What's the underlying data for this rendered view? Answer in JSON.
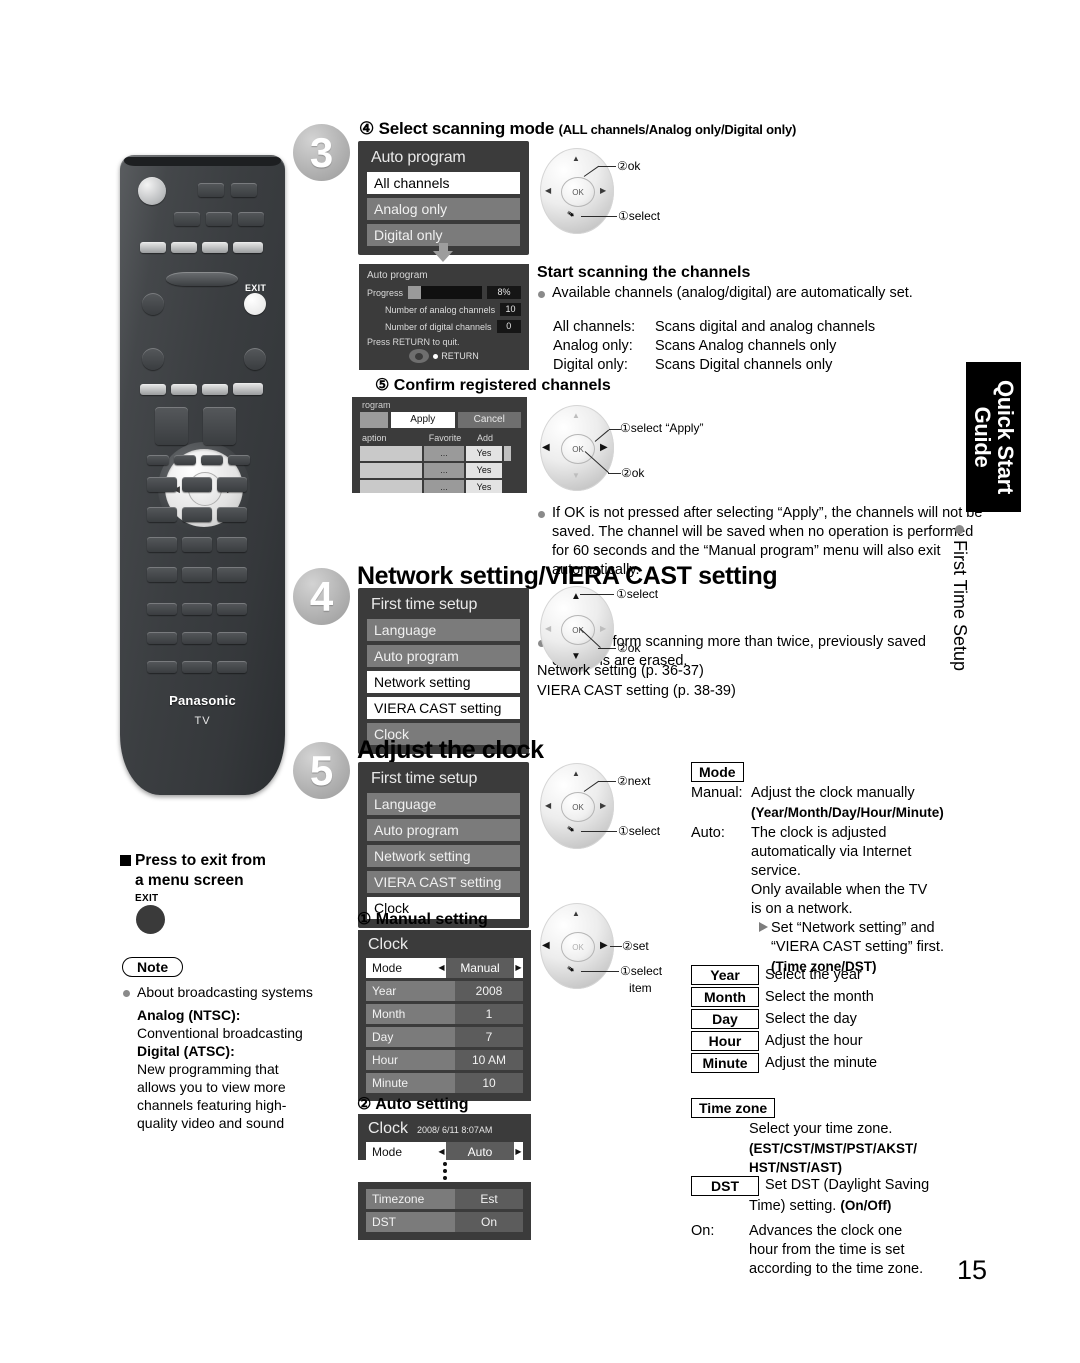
{
  "page": {
    "number": "15"
  },
  "side_tab": {
    "title_line1": "Quick Start",
    "title_line2": "Guide",
    "subtitle": "First Time Setup"
  },
  "remote": {
    "brand": "Panasonic",
    "model_label": "TV",
    "exit_label": "EXIT",
    "ok_label": "OK"
  },
  "step3": {
    "number": "3",
    "heading_num": "④",
    "heading": "Select scanning mode",
    "heading_paren": "(ALL channels/Analog only/Digital only)",
    "menu": {
      "title": "Auto program",
      "items": [
        {
          "label": "All channels",
          "selected": true
        },
        {
          "label": "Analog only",
          "selected": false
        },
        {
          "label": "Digital only",
          "selected": false
        }
      ]
    },
    "dial": {
      "callout1": "②ok",
      "callout2": "①select",
      "ok": "OK"
    },
    "progress_panel": {
      "title": "Auto program",
      "progress_label": "Progress",
      "progress_value": "8%",
      "progress_percent": 8,
      "analog_label": "Number of analog channels",
      "analog_value": "10",
      "digital_label": "Number of digital channels",
      "digital_value": "0",
      "quit_text": "Press RETURN to quit.",
      "return_label": "RETURN"
    },
    "scanning": {
      "heading": "Start scanning the channels",
      "bullet": "Available channels (analog/digital) are automatically set.",
      "rows": [
        {
          "key": "All channels:",
          "val": "Scans digital and analog channels"
        },
        {
          "key": "Analog only:",
          "val": "Scans Analog channels only"
        },
        {
          "key": "Digital only:",
          "val": "Scans Digital channels only"
        }
      ]
    },
    "confirm": {
      "heading_num": "⑤",
      "heading": "Confirm registered channels",
      "panel": {
        "title": "rogram",
        "apply": "Apply",
        "cancel": "Cancel",
        "col_caption": "aption",
        "col_favorite": "Favorite",
        "col_add": "Add",
        "rows": [
          {
            "dash": ".",
            "fav": "...",
            "add": "Yes"
          },
          {
            "dash": ".",
            "fav": "...",
            "add": "Yes"
          },
          {
            "dash": ".",
            "fav": "...",
            "add": "Yes"
          }
        ]
      },
      "dial": {
        "callout1": "①select “Apply”",
        "callout2": "②ok",
        "ok": "OK"
      },
      "bullets": [
        "If OK is not pressed after selecting “Apply”, the channels will not be saved. The channel will be saved when no operation is performed for 60 seconds and the “Manual program” menu will also exit automatically.",
        "If you perform scanning more than twice, previously saved channels are erased."
      ]
    }
  },
  "step4": {
    "number": "4",
    "heading": "Network setting/VIERA CAST setting",
    "menu": {
      "title": "First time setup",
      "items": [
        {
          "label": "Language",
          "selected": false
        },
        {
          "label": "Auto program",
          "selected": false
        },
        {
          "label": "Network setting",
          "selected": true
        },
        {
          "label": "VIERA CAST setting",
          "selected": true
        },
        {
          "label": "Clock",
          "selected": false
        }
      ]
    },
    "dial": {
      "callout1": "①select",
      "callout2": "②ok",
      "ok": "OK"
    },
    "refs": [
      "Network setting (p. 36-37)",
      "VIERA CAST setting (p. 38-39)"
    ]
  },
  "step5": {
    "number": "5",
    "heading": "Adjust the clock",
    "menu": {
      "title": "First time setup",
      "items": [
        {
          "label": "Language",
          "selected": false
        },
        {
          "label": "Auto program",
          "selected": false
        },
        {
          "label": "Network setting",
          "selected": false
        },
        {
          "label": "VIERA CAST setting",
          "selected": false
        },
        {
          "label": "Clock",
          "selected": true
        }
      ]
    },
    "dial": {
      "callout1": "②next",
      "callout2": "①select",
      "ok": "OK"
    },
    "manual": {
      "heading_num": "①",
      "heading": "Manual setting",
      "title": "Clock",
      "rows": [
        {
          "key": "Mode",
          "val": "Manual",
          "arrows": true,
          "white": true
        },
        {
          "key": "Year",
          "val": "2008",
          "arrows": false,
          "white": false
        },
        {
          "key": "Month",
          "val": "1",
          "arrows": false,
          "white": false
        },
        {
          "key": "Day",
          "val": "7",
          "arrows": false,
          "white": false
        },
        {
          "key": "Hour",
          "val": "10 AM",
          "arrows": false,
          "white": false
        },
        {
          "key": "Minute",
          "val": "10",
          "arrows": false,
          "white": false
        }
      ],
      "dial": {
        "callout1": "②set",
        "callout2": "①select",
        "callout2b": "item",
        "ok": "OK"
      }
    },
    "auto": {
      "heading_num": "②",
      "heading": "Auto setting",
      "title": "Clock",
      "timestamp": "2008/ 6/11 8:07AM",
      "mode_key": "Mode",
      "mode_val": "Auto",
      "rows": [
        {
          "key": "Timezone",
          "val": "Est"
        },
        {
          "key": "DST",
          "val": "On"
        }
      ]
    },
    "mode_desc": {
      "box": "Mode",
      "manual_key": "Manual:",
      "manual_val1": "Adjust the clock manually",
      "manual_val2": "(Year/Month/Day/Hour/Minute)",
      "auto_key": "Auto:",
      "auto_lines": [
        "The clock is adjusted",
        "automatically via Internet",
        "service.",
        "Only available when the TV",
        "is on a network."
      ],
      "arrow_line1": "Set “Network setting” and",
      "arrow_line2": "“VIERA CAST setting” first.",
      "arrow_line3": "(Time zone/DST)"
    },
    "field_defs": [
      {
        "box": "Year",
        "desc": "Select the year"
      },
      {
        "box": "Month",
        "desc": "Select the month"
      },
      {
        "box": "Day",
        "desc": "Select the day"
      },
      {
        "box": "Hour",
        "desc": "Adjust the hour"
      },
      {
        "box": "Minute",
        "desc": "Adjust the minute"
      }
    ],
    "timezone": {
      "box": "Time zone",
      "line1": "Select your time zone.",
      "line2": "(EST/CST/MST/PST/AKST/",
      "line3": "HST/NST/AST)"
    },
    "dst": {
      "box": "DST",
      "line1": "Set DST (Daylight Saving",
      "line2a": "Time) setting. ",
      "line2b": "(On/Off)",
      "on_key": "On:",
      "on_lines": [
        "Advances the clock one",
        "hour from the time is set",
        "according to the time zone."
      ]
    }
  },
  "exit_section": {
    "heading_line1": "Press to exit from",
    "heading_line2": "a menu screen",
    "button_label": "EXIT"
  },
  "note": {
    "title": "Note",
    "bullet": "About broadcasting systems",
    "analog_head": "Analog (NTSC):",
    "analog_body": "Conventional broadcasting",
    "digital_head": "Digital (ATSC):",
    "digital_body": "New programming that allows you to view more channels featuring high-quality video and sound"
  }
}
